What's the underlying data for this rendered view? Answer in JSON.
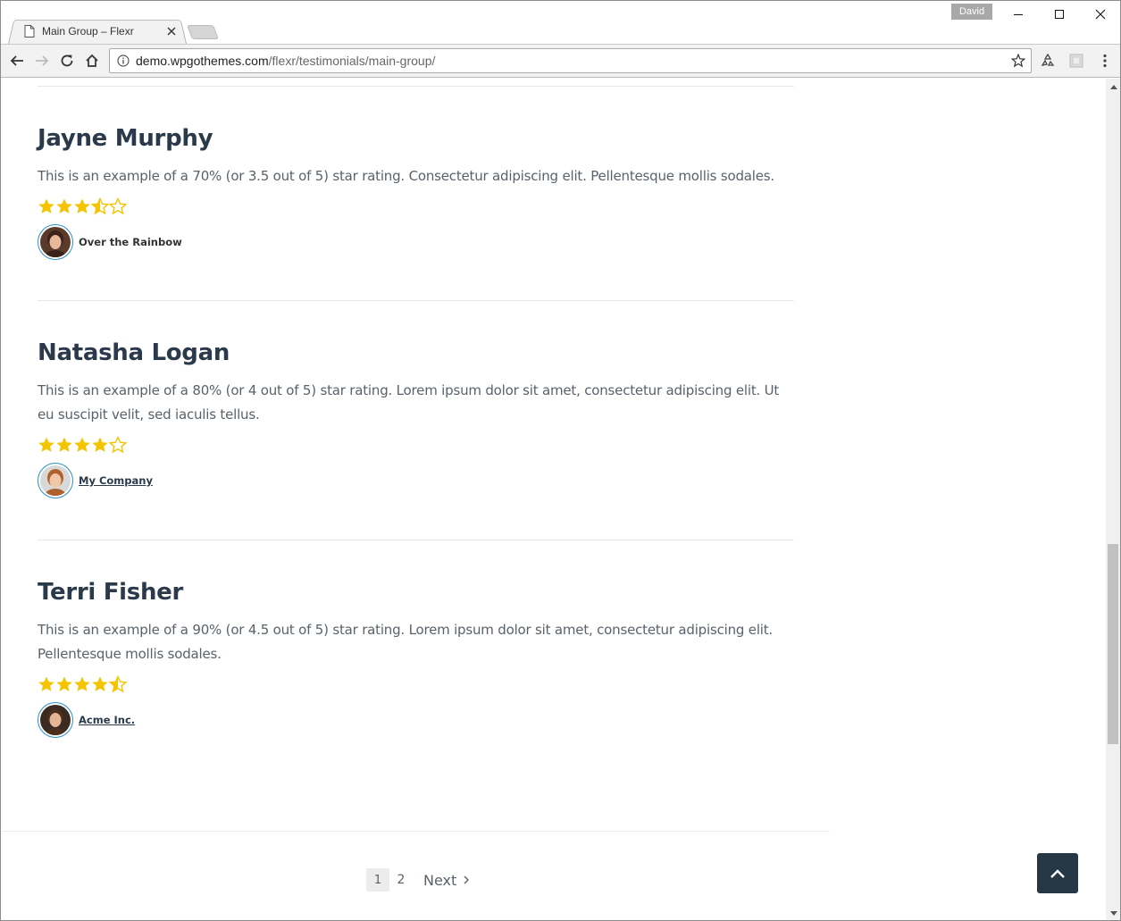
{
  "browser": {
    "tab_title": "Main Group – Flexr",
    "profile_name": "David",
    "url_host": "demo.wpgothemes.com",
    "url_path": "/flexr/testimonials/main-group/"
  },
  "testimonials": [
    {
      "name": "Jayne Murphy",
      "text": "This is an example of a 70% (or 3.5 out of 5) star rating. Consectetur adipiscing elit. Pellentesque mollis sodales.",
      "rating": 3.5,
      "company": "Over the Rainbow",
      "company_is_link": false
    },
    {
      "name": "Natasha Logan",
      "text": "This is an example of a 80% (or 4 out of 5) star rating. Lorem ipsum dolor sit amet, consectetur adipiscing elit. Ut eu suscipit velit, sed iaculis tellus.",
      "rating": 4,
      "company": "My Company",
      "company_is_link": true
    },
    {
      "name": "Terri Fisher",
      "text": "This is an example of a 90% (or 4.5 out of 5) star rating. Lorem ipsum dolor sit amet, consectetur adipiscing elit. Pellentesque mollis sodales.",
      "rating": 4.5,
      "company": "Acme Inc.",
      "company_is_link": true
    }
  ],
  "pagination": {
    "pages": [
      "1",
      "2"
    ],
    "current": "1",
    "next_label": "Next"
  },
  "colors": {
    "star": "#f5c400",
    "heading": "#2b3a4a",
    "body_text": "#59626b",
    "avatar_ring": "#2a8fc5",
    "back_to_top": "#263746"
  }
}
